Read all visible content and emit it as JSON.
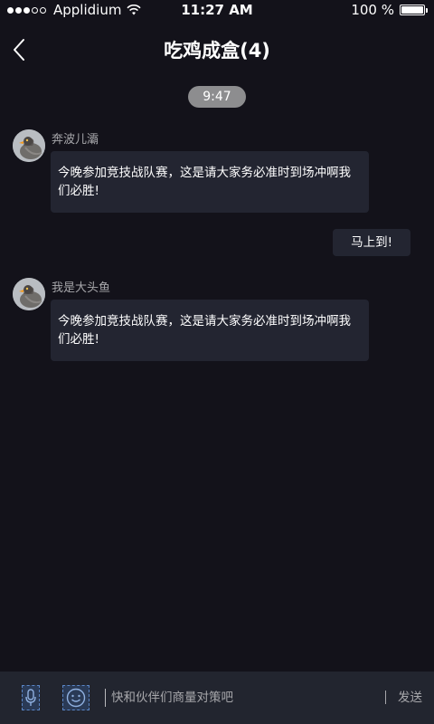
{
  "status_bar": {
    "carrier": "Applidium",
    "time": "11:27 AM",
    "battery_percent": "100 %",
    "battery_level": 1.0,
    "signal_bars_filled": 3,
    "signal_bars_total": 5
  },
  "nav": {
    "title": "吃鸡成盒(4)",
    "back_icon": "chevron-left-icon"
  },
  "chat": {
    "timestamp": "9:47",
    "messages": [
      {
        "sender": "奔波儿灞",
        "text": "今晚参加竞技战队赛，这是请大家务必准时到场冲啊我们必胜!",
        "avatar_icon": "bird-avatar-icon"
      },
      {
        "sender": "me",
        "text": "马上到!"
      },
      {
        "sender": "我是大头鱼",
        "text": "今晚参加竞技战队赛，这是请大家务必准时到场冲啊我们必胜!",
        "avatar_icon": "bird-avatar-icon"
      }
    ]
  },
  "input_bar": {
    "placeholder": "快和伙伴们商量对策吧",
    "send_label": "发送",
    "voice_icon": "microphone-icon",
    "emoji_icon": "emoji-icon"
  },
  "colors": {
    "background": "#13121a",
    "bubble": "#232531",
    "input_bar": "#22252f",
    "muted_text": "#a7a7ab",
    "time_pill": "#8d8d8f"
  }
}
